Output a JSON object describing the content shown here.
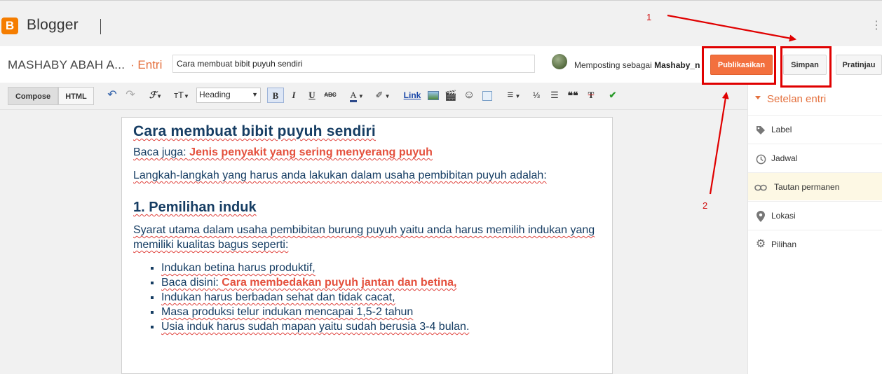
{
  "header": {
    "brand": "Blogger",
    "logo_letter": "B",
    "menu_glyph": "⋮"
  },
  "postbar": {
    "blog_name": "MASHABY ABAH A...",
    "separator": "·",
    "section": "Entri",
    "title_value": "Cara membuat bibit puyuh sendiri",
    "posting_as_prefix": "Memposting sebagai",
    "posting_as_user": "Mashaby_nb",
    "publish_label": "Publikasikan",
    "save_label": "Simpan",
    "preview_label": "Pratinjau"
  },
  "toolbar": {
    "compose_label": "Compose",
    "html_label": "HTML",
    "heading_value": "Heading",
    "link_label": "Link",
    "bold_glyph": "B",
    "italic_glyph": "I",
    "underline_glyph": "U",
    "strike_glyph": "ABC",
    "font_glyph": "ℱ",
    "size_glyph": "тT",
    "text_color_glyph": "A",
    "highlight_glyph": "✐",
    "undo_glyph": "↶",
    "redo_glyph": "↷",
    "video_glyph": "🎬",
    "emoji_glyph": "☺",
    "align_glyph": "≡",
    "ol_glyph": "⅓",
    "ul_glyph": "☰",
    "quote_glyph": "❝❝",
    "clear_glyph": "T",
    "spell_glyph": "✔"
  },
  "post": {
    "title": "Cara membuat bibit puyuh sendiri",
    "read_also_prefix": "Baca juga: ",
    "read_also_link": "Jenis penyakit yang sering menyerang puyuh",
    "intro": "Langkah-langkah yang harus anda lakukan dalam usaha pembibitan puyuh adalah:",
    "section1_heading": "1. Pemilihan induk",
    "section1_para": "Syarat utama dalam usaha pembibitan burung puyuh yaitu anda harus memilih indukan yang memiliki kualitas bagus seperti:",
    "list": [
      {
        "text": "Indukan betina harus produktif,"
      },
      {
        "prefix": "Baca disini: ",
        "link": "Cara membedakan puyuh jantan dan betina,"
      },
      {
        "text": "Indukan harus berbadan sehat dan tidak cacat,"
      },
      {
        "text": "Masa produksi telur indukan mencapai 1,5-2 tahun"
      },
      {
        "text": "Usia induk harus sudah mapan yaitu sudah berusia 3-4 bulan."
      }
    ]
  },
  "sidebar": {
    "heading": "Setelan entri",
    "items": [
      {
        "label": "Label",
        "icon": "tag-icon"
      },
      {
        "label": "Jadwal",
        "icon": "clock-icon"
      },
      {
        "label": "Tautan permanen",
        "icon": "link-icon",
        "active": true
      },
      {
        "label": "Lokasi",
        "icon": "location-pin-icon"
      },
      {
        "label": "Pilihan",
        "icon": "gear-icon"
      }
    ]
  },
  "annotations": {
    "step1": "1",
    "step2": "2"
  },
  "colors": {
    "accent": "#e4703d",
    "publish": "#f3703e",
    "annotation": "#e00000",
    "post_text": "#163d63",
    "post_link": "#e4503d"
  }
}
